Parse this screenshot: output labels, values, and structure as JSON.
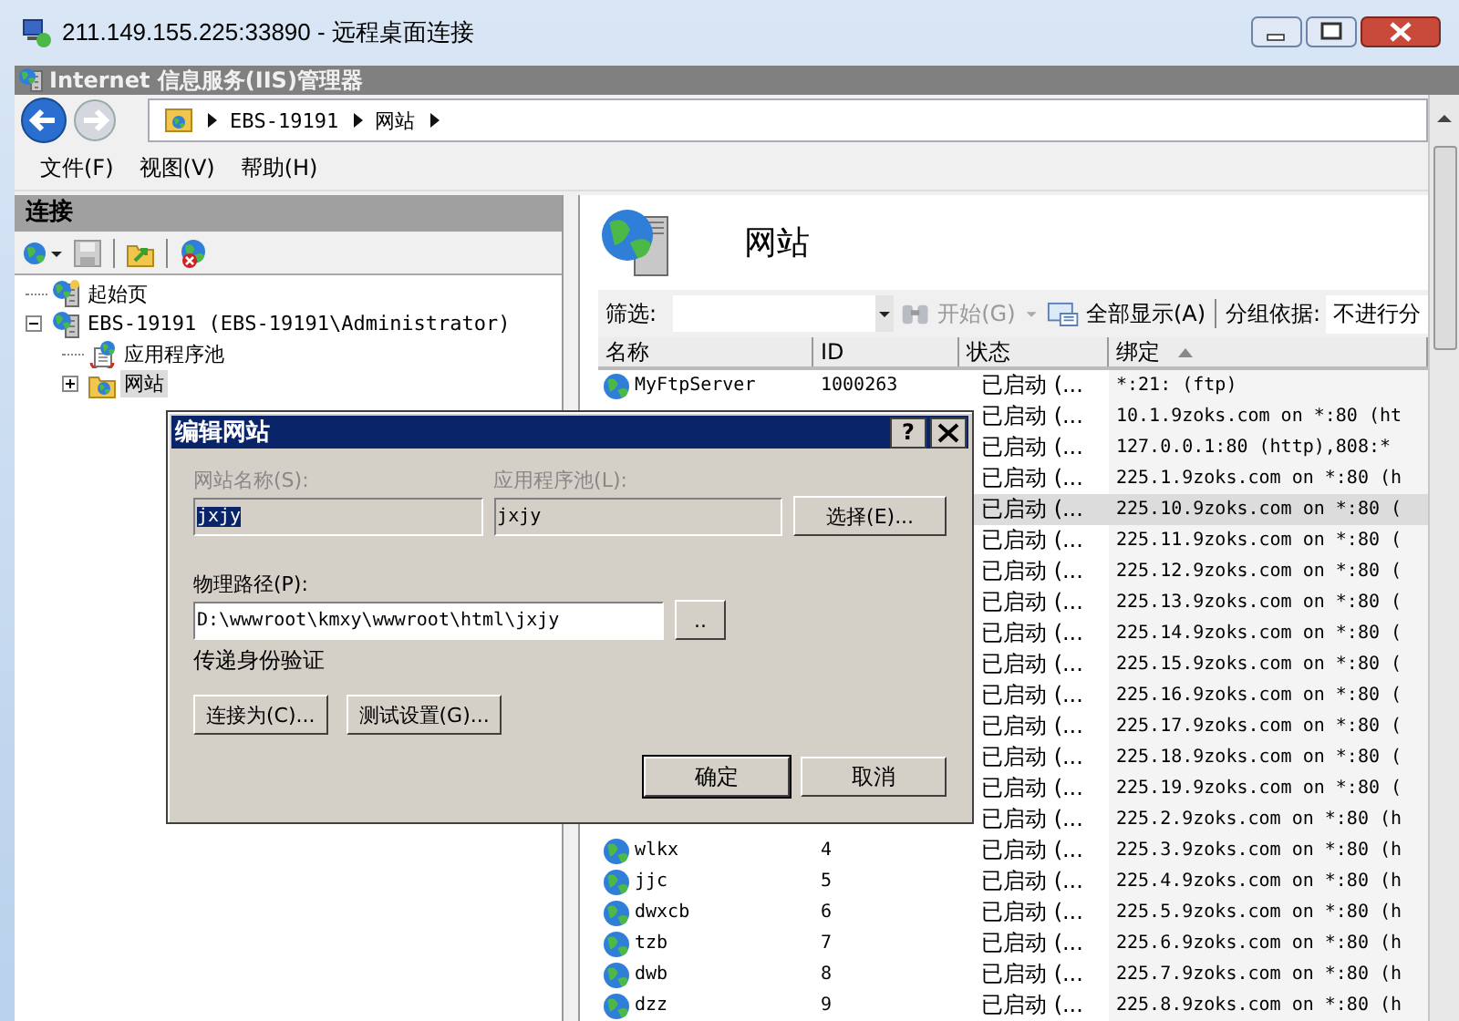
{
  "window": {
    "title": "211.149.155.225:33890 - 远程桌面连接"
  },
  "app": {
    "title": "Internet 信息服务(IIS)管理器"
  },
  "address": {
    "segments": [
      "EBS-19191",
      "网站"
    ]
  },
  "menu": [
    "文件(F)",
    "视图(V)",
    "帮助(H)"
  ],
  "connections": {
    "title": "连接",
    "tree": [
      {
        "label": "起始页",
        "kind": "home",
        "selected": false
      },
      {
        "label": "EBS-19191 (EBS-19191\\Administrator)",
        "kind": "server",
        "selected": false,
        "expanded": true,
        "children": [
          {
            "label": "应用程序池",
            "kind": "pool",
            "selected": false
          },
          {
            "label": "网站",
            "kind": "sites",
            "selected": true,
            "expanded": false
          }
        ]
      }
    ]
  },
  "content": {
    "title": "网站",
    "filter": {
      "label": "筛选:",
      "go": "开始(G)",
      "go_disabled": true,
      "show_all": "全部显示(A)",
      "group_label": "分组依据:",
      "group_value": "不进行分"
    },
    "columns": [
      {
        "label": "名称",
        "sorted": false
      },
      {
        "label": "ID",
        "sorted": false
      },
      {
        "label": "状态",
        "sorted": false
      },
      {
        "label": "绑定",
        "sorted": true
      }
    ],
    "rows": [
      {
        "name": "MyFtpServer",
        "id": "1000263",
        "status": "已启动 (...",
        "binding": "*:21: (ftp)",
        "selected": false
      },
      {
        "status": "已启动 (...",
        "binding": "10.1.9zoks.com on *:80 (ht",
        "selected": false
      },
      {
        "status": "已启动 (...",
        "binding": "127.0.0.1:80 (http),808:*",
        "selected": false
      },
      {
        "status": "已启动 (...",
        "binding": "225.1.9zoks.com on *:80 (h",
        "selected": false
      },
      {
        "status": "已启动 (...",
        "binding": "225.10.9zoks.com on *:80 (",
        "selected": true
      },
      {
        "status": "已启动 (...",
        "binding": "225.11.9zoks.com on *:80 (",
        "selected": false
      },
      {
        "status": "已启动 (...",
        "binding": "225.12.9zoks.com on *:80 (",
        "selected": false
      },
      {
        "status": "已启动 (...",
        "binding": "225.13.9zoks.com on *:80 (",
        "selected": false
      },
      {
        "status": "已启动 (...",
        "binding": "225.14.9zoks.com on *:80 (",
        "selected": false
      },
      {
        "status": "已启动 (...",
        "binding": "225.15.9zoks.com on *:80 (",
        "selected": false
      },
      {
        "status": "已启动 (...",
        "binding": "225.16.9zoks.com on *:80 (",
        "selected": false
      },
      {
        "status": "已启动 (...",
        "binding": "225.17.9zoks.com on *:80 (",
        "selected": false
      },
      {
        "status": "已启动 (...",
        "binding": "225.18.9zoks.com on *:80 (",
        "selected": false
      },
      {
        "status": "已启动 (...",
        "binding": "225.19.9zoks.com on *:80 (",
        "selected": false
      },
      {
        "status": "已启动 (...",
        "binding": "225.2.9zoks.com on *:80 (h",
        "selected": false
      },
      {
        "name": "wlkx",
        "id": "4",
        "status": "已启动 (...",
        "binding": "225.3.9zoks.com on *:80 (h",
        "selected": false
      },
      {
        "name": "jjc",
        "id": "5",
        "status": "已启动 (...",
        "binding": "225.4.9zoks.com on *:80 (h",
        "selected": false
      },
      {
        "name": "dwxcb",
        "id": "6",
        "status": "已启动 (...",
        "binding": "225.5.9zoks.com on *:80 (h",
        "selected": false
      },
      {
        "name": "tzb",
        "id": "7",
        "status": "已启动 (...",
        "binding": "225.6.9zoks.com on *:80 (h",
        "selected": false
      },
      {
        "name": "dwb",
        "id": "8",
        "status": "已启动 (...",
        "binding": "225.7.9zoks.com on *:80 (h",
        "selected": false
      },
      {
        "name": "dzz",
        "id": "9",
        "status": "已启动 (...",
        "binding": "225.8.9zoks.com on *:80 (h",
        "selected": false
      }
    ]
  },
  "dialog": {
    "title": "编辑网站",
    "help": "?",
    "site_name": {
      "label": "网站名称(S):",
      "value": "jxjy",
      "disabled": true,
      "highlighted": true
    },
    "app_pool": {
      "label": "应用程序池(L):",
      "value": "jxjy",
      "disabled": true
    },
    "select_button": "选择(E)...",
    "path": {
      "label": "物理路径(P):",
      "value": "D:\\wwwroot\\kmxy\\wwwroot\\html\\jxjy"
    },
    "browse_button": "..",
    "auth_label": "传递身份验证",
    "buttons": [
      {
        "label": "连接为(C)...",
        "kind": "action"
      },
      {
        "label": "测试设置(G)...",
        "kind": "action"
      }
    ],
    "footer_buttons": [
      {
        "label": "确定",
        "default": true
      },
      {
        "label": "取消",
        "default": false
      }
    ]
  }
}
